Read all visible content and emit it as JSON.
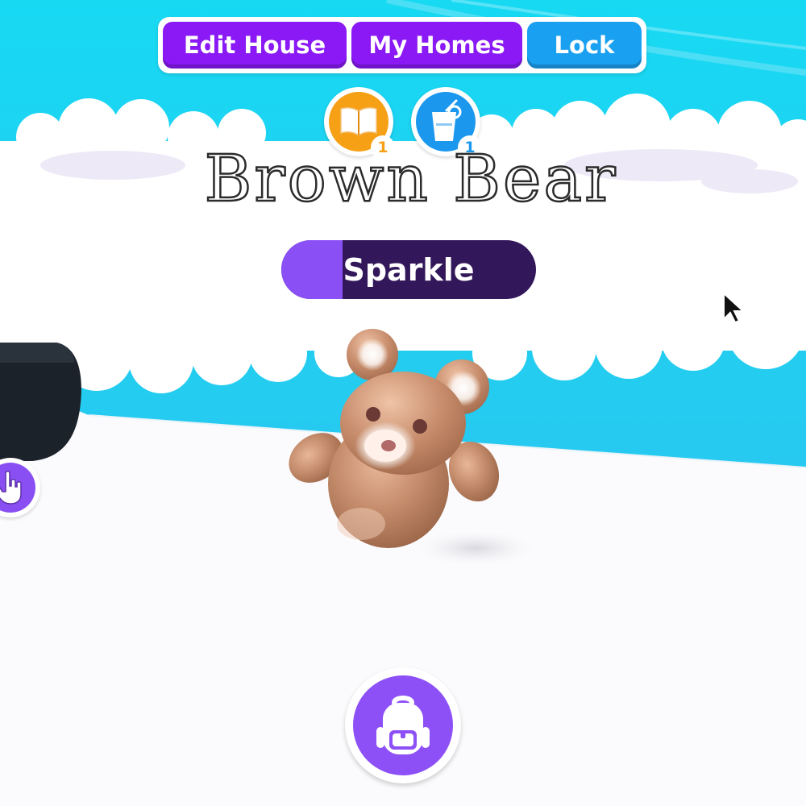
{
  "toolbar": {
    "edit_house": "Edit House",
    "my_homes": "My Homes",
    "lock": "Lock"
  },
  "status_icons": [
    {
      "name": "book",
      "count": "1",
      "color": "#f6a016"
    },
    {
      "name": "drink",
      "count": "1",
      "color": "#1b98ee"
    }
  ],
  "pet": {
    "name": "Brown Bear",
    "tag": "Sparkle",
    "tag_progress": 0.24
  },
  "colors": {
    "sky": "#1fd6f2",
    "accent_purple": "#8a19f5",
    "accent_blue": "#1aa0f1",
    "tag_dark": "#32185a",
    "tag_light": "#8b4ff6"
  }
}
